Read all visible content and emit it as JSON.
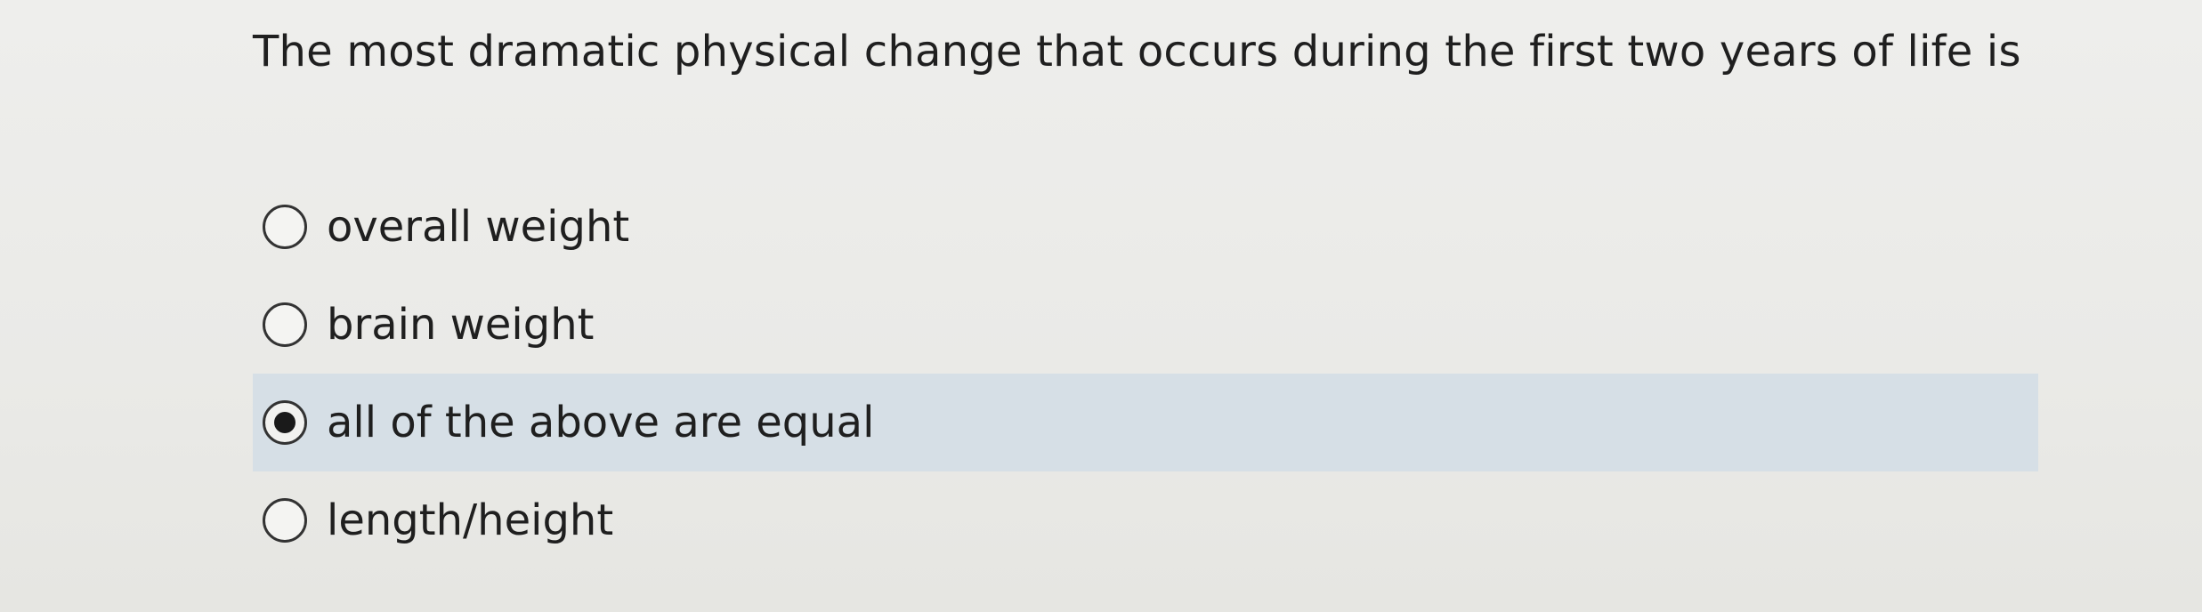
{
  "question": {
    "text": "The most dramatic physical change that occurs during the first two years of life is"
  },
  "options": [
    {
      "label": "overall weight",
      "selected": false
    },
    {
      "label": "brain weight",
      "selected": false
    },
    {
      "label": "all of the above are equal",
      "selected": true
    },
    {
      "label": "length/height",
      "selected": false
    }
  ],
  "colors": {
    "background": "#eaeae7",
    "selected_row": "#d6dfe6",
    "text": "#1f1f1f",
    "radio_border": "#333333"
  },
  "icons": {
    "radio_unselected": "radio-empty-icon",
    "radio_selected": "radio-filled-icon"
  }
}
